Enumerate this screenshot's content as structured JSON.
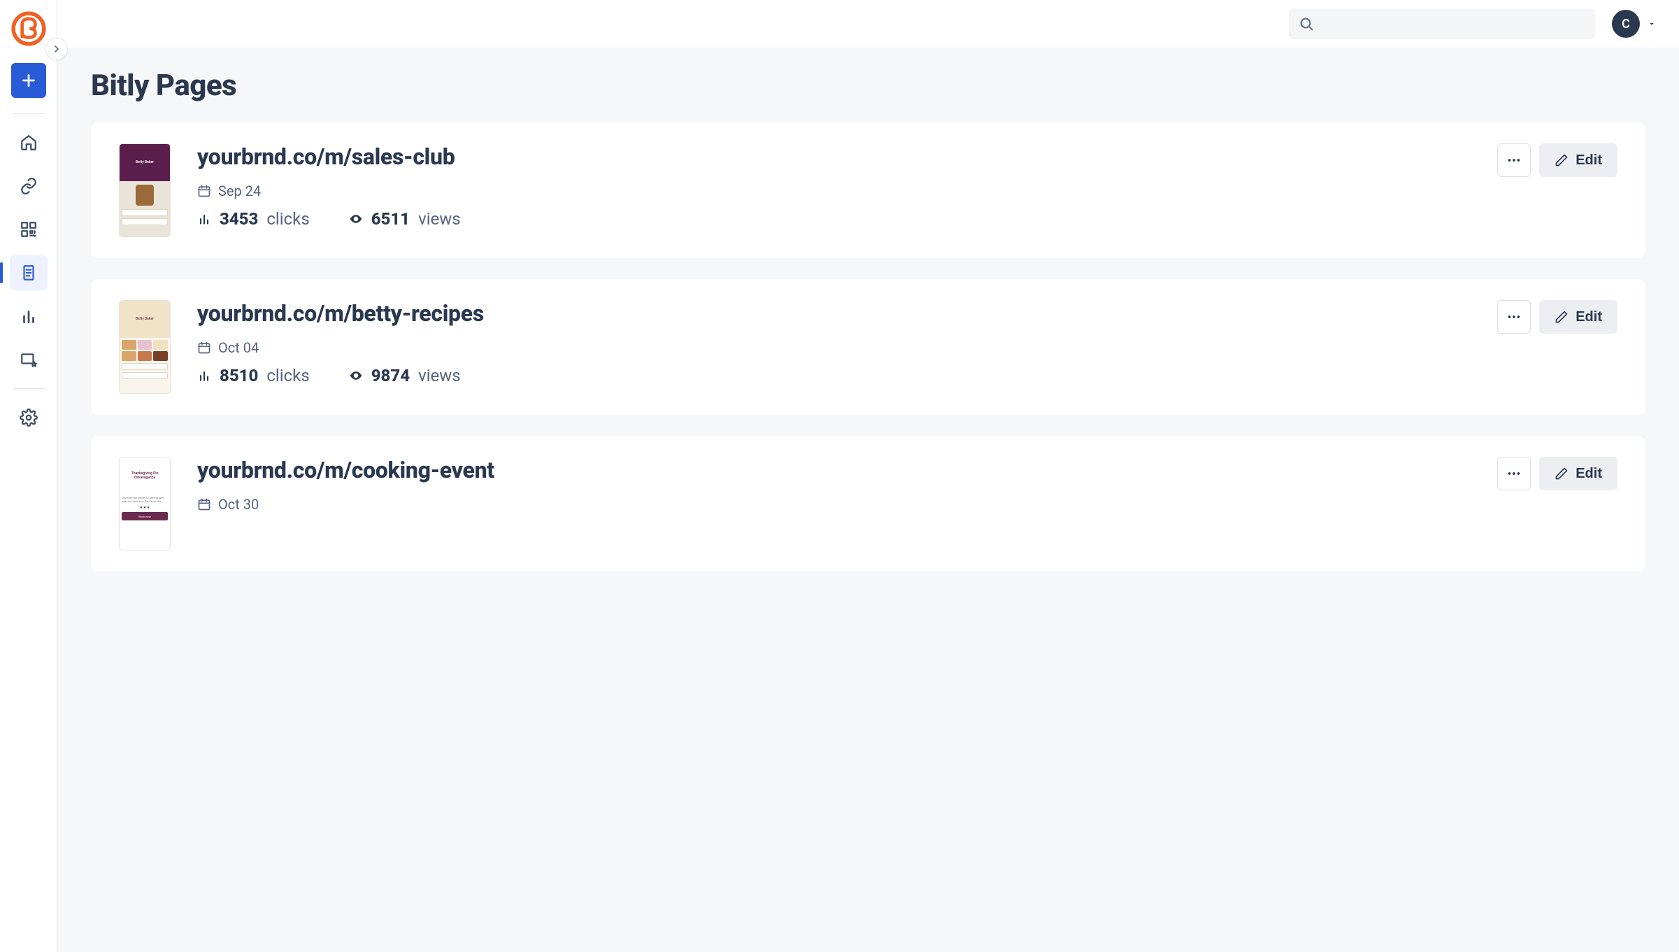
{
  "account": {
    "initial": "C"
  },
  "header": {
    "page_title": "Bitly Pages"
  },
  "labels": {
    "clicks": "clicks",
    "views": "views",
    "edit": "Edit"
  },
  "pages": [
    {
      "url": "yourbrnd.co/m/sales-club",
      "date": "Sep 24",
      "clicks": "3453",
      "views": "6511",
      "thumb_variant": "sales",
      "thumb_title": "Betty Baker"
    },
    {
      "url": "yourbrnd.co/m/betty-recipes",
      "date": "Oct 04",
      "clicks": "8510",
      "views": "9874",
      "thumb_variant": "recipes",
      "thumb_title": "Betty Baker"
    },
    {
      "url": "yourbrnd.co/m/cooking-event",
      "date": "Oct 30",
      "clicks": "",
      "views": "",
      "thumb_variant": "event",
      "thumb_title": "Thanksgiving Pie Extravaganza"
    }
  ]
}
